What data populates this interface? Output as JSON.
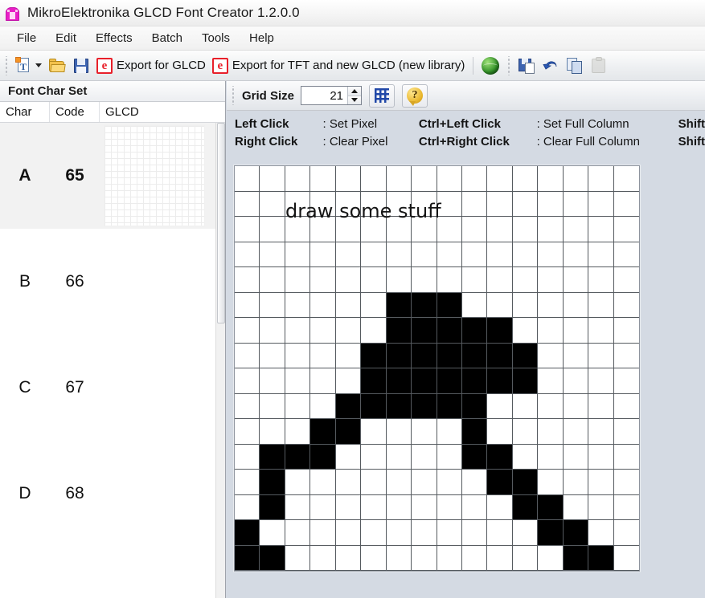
{
  "window": {
    "title": "MikroElektronika GLCD Font Creator 1.2.0.0",
    "icon": "app-icon"
  },
  "menubar": {
    "items": [
      {
        "label": "File"
      },
      {
        "label": "Edit"
      },
      {
        "label": "Effects"
      },
      {
        "label": "Batch"
      },
      {
        "label": "Tools"
      },
      {
        "label": "Help"
      }
    ]
  },
  "toolbar": {
    "new_font_label": "",
    "export_glcd_label": "Export for GLCD",
    "export_tft_label": "Export for TFT and new GLCD (new library)",
    "icons": [
      "new-font-icon",
      "open-icon",
      "save-icon",
      "export-glcd-icon",
      "export-tft-icon",
      "globe-icon",
      "save-as-icon",
      "undo-icon",
      "copy-icon",
      "paste-icon"
    ]
  },
  "left_panel": {
    "header": "Font Char Set",
    "columns": [
      "Char",
      "Code",
      "GLCD"
    ],
    "rows": [
      {
        "char": "A",
        "code": "65",
        "selected": true,
        "has_preview": true
      },
      {
        "char": "B",
        "code": "66",
        "selected": false,
        "has_preview": false
      },
      {
        "char": "C",
        "code": "67",
        "selected": false,
        "has_preview": false
      },
      {
        "char": "D",
        "code": "68",
        "selected": false,
        "has_preview": false
      }
    ]
  },
  "grid_toolbar": {
    "grid_size_label": "Grid Size",
    "grid_size_value": "21",
    "grid_toggle_icon": "grid-icon",
    "help_icon": "help-icon",
    "help_glyph": "?"
  },
  "hints": {
    "rows": [
      {
        "key1": "Left Click",
        "val1": ": Set Pixel",
        "key2": "Ctrl+Left Click",
        "val2": ": Set Full Column",
        "key3": "Shift"
      },
      {
        "key1": "Right Click",
        "val1": ": Clear Pixel",
        "key2": "Ctrl+Right Click",
        "val2": ": Clear Full Column",
        "key3": "Shift"
      }
    ]
  },
  "canvas": {
    "annotation": "draw some stuff",
    "columns": 16,
    "rows": 16,
    "pixels": [
      [
        0,
        0,
        0,
        0,
        0,
        0,
        0,
        0,
        0,
        0,
        0,
        0,
        0,
        0,
        0,
        0
      ],
      [
        0,
        0,
        0,
        0,
        0,
        0,
        0,
        0,
        0,
        0,
        0,
        0,
        0,
        0,
        0,
        0
      ],
      [
        0,
        0,
        0,
        0,
        0,
        0,
        0,
        0,
        0,
        0,
        0,
        0,
        0,
        0,
        0,
        0
      ],
      [
        0,
        0,
        0,
        0,
        0,
        0,
        0,
        0,
        0,
        0,
        0,
        0,
        0,
        0,
        0,
        0
      ],
      [
        0,
        0,
        0,
        0,
        0,
        0,
        0,
        0,
        0,
        0,
        0,
        0,
        0,
        0,
        0,
        0
      ],
      [
        0,
        0,
        0,
        0,
        0,
        0,
        1,
        1,
        1,
        0,
        0,
        0,
        0,
        0,
        0,
        0
      ],
      [
        0,
        0,
        0,
        0,
        0,
        0,
        1,
        1,
        1,
        1,
        1,
        0,
        0,
        0,
        0,
        0
      ],
      [
        0,
        0,
        0,
        0,
        0,
        1,
        1,
        1,
        1,
        1,
        1,
        1,
        0,
        0,
        0,
        0
      ],
      [
        0,
        0,
        0,
        0,
        0,
        1,
        1,
        1,
        1,
        1,
        1,
        1,
        0,
        0,
        0,
        0
      ],
      [
        0,
        0,
        0,
        0,
        1,
        1,
        1,
        1,
        1,
        1,
        0,
        0,
        0,
        0,
        0,
        0
      ],
      [
        0,
        0,
        0,
        1,
        1,
        0,
        0,
        0,
        0,
        1,
        0,
        0,
        0,
        0,
        0,
        0
      ],
      [
        0,
        1,
        1,
        1,
        0,
        0,
        0,
        0,
        0,
        1,
        1,
        0,
        0,
        0,
        0,
        0
      ],
      [
        0,
        1,
        0,
        0,
        0,
        0,
        0,
        0,
        0,
        0,
        1,
        1,
        0,
        0,
        0,
        0
      ],
      [
        0,
        1,
        0,
        0,
        0,
        0,
        0,
        0,
        0,
        0,
        0,
        1,
        1,
        0,
        0,
        0
      ],
      [
        1,
        0,
        0,
        0,
        0,
        0,
        0,
        0,
        0,
        0,
        0,
        0,
        1,
        1,
        0,
        0
      ],
      [
        1,
        1,
        0,
        0,
        0,
        0,
        0,
        0,
        0,
        0,
        0,
        0,
        0,
        1,
        1,
        0
      ]
    ]
  },
  "colors": {
    "accent": "#e81ec6",
    "export_icon": "#e8202a",
    "pixel_on": "#000000",
    "pixel_off": "#ffffff",
    "window_bg": "#d4dae3"
  }
}
